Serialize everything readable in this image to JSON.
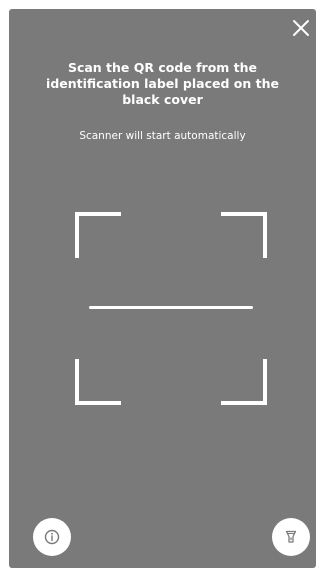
{
  "scanner": {
    "title": "Scan the QR code from the identification label placed on the black cover",
    "subtitle": "Scanner will start automatically"
  },
  "icons": {
    "close": "close-icon",
    "info": "info-icon",
    "flashlight": "flashlight-icon"
  },
  "colors": {
    "overlay": "#7a7a7a",
    "foreground": "#ffffff",
    "icon": "#7a7a7a"
  }
}
